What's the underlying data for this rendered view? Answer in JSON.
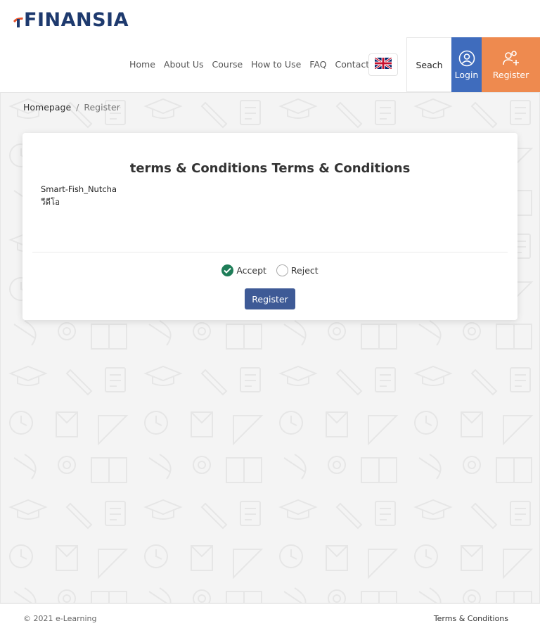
{
  "brand": {
    "logo_text": "FINANSIA",
    "logo_color": "#1e3a6e",
    "logo_accent": "#e4532d"
  },
  "nav": {
    "items": [
      "Home",
      "About Us",
      "Course",
      "How to Use",
      "FAQ",
      "Contact Us"
    ],
    "language_icon": "uk-flag-icon",
    "search_label": "Seach",
    "login_label": "Login",
    "register_label": "Register"
  },
  "colors": {
    "login_bg": "#3f6cbd",
    "register_bg": "#ee8a4f",
    "submit_bg": "#3e5a96",
    "accept_checked": "#1e7d58"
  },
  "breadcrumb": {
    "home": "Homepage",
    "separator": "/",
    "current": "Register"
  },
  "terms": {
    "title": "terms & Conditions Terms & Conditions",
    "line1": "Smart-Fish_Nutcha",
    "line2": "วีดีโอ",
    "accept_label": "Accept",
    "reject_label": "Reject",
    "accept_selected": true,
    "submit_label": "Register"
  },
  "footer": {
    "copyright": "© 2021 e-Learning",
    "terms_link": "Terms & Conditions"
  }
}
